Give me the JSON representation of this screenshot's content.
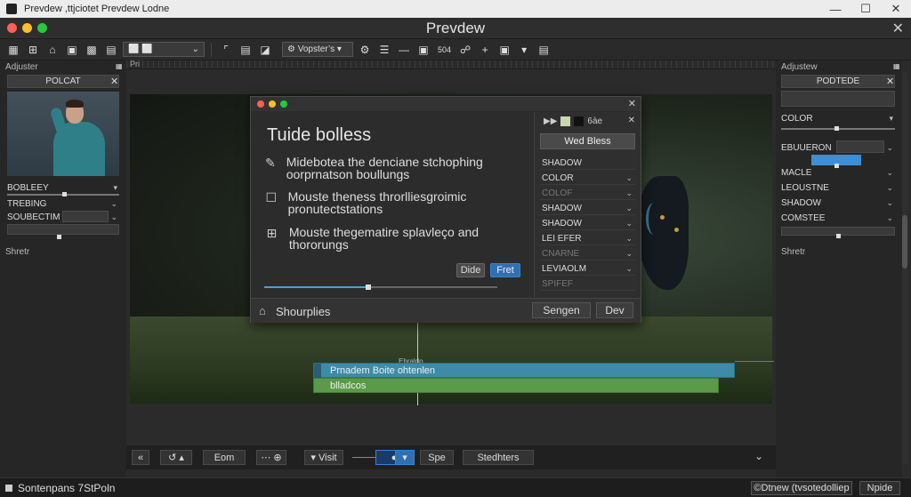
{
  "window": {
    "os_title": "Prevdew ,ttjciotet Prevdew Lodne",
    "app_title": "Prevdew"
  },
  "toolbar": {
    "select_left": "⬜ ⬜",
    "preset_label": "Vopster’s",
    "btn_504": "504",
    "ruler_label": "Pri"
  },
  "left_panel": {
    "label": "Adjuster",
    "head": "POLCAT",
    "props": [
      "BOBLEEY",
      "TREBING",
      "SOUBECTIM"
    ],
    "footer": "Shretr"
  },
  "right_panel": {
    "label": "Adjustew",
    "head": "PODTEDE",
    "props": [
      "COLOR",
      "EBUUERON",
      "MACLE",
      "LEOUSTNE",
      "SHADOW",
      "COMSTEE"
    ],
    "footer": "Shretr"
  },
  "dialog": {
    "title": "Tuide bolless",
    "items": [
      "Midebotea the denciane stchophing oorprnatson boullungs",
      "Mouste theness throrlliesgroimic pronutectstations",
      "Mouste thegematire splavleço and thororungs"
    ],
    "btn_secondary": "Dide",
    "btn_primary": "Fret",
    "footer_label": "Shourplies",
    "footer_btn1": "Sengen",
    "footer_btn2": "Dev",
    "slider_value": 0.44
  },
  "dialog_list": {
    "top_label": "6àe",
    "head": "Wed Bless",
    "rows": [
      {
        "label": "SHADOW",
        "dim": false,
        "chev": false
      },
      {
        "label": "COLOR",
        "dim": false,
        "chev": true
      },
      {
        "label": "COLOF",
        "dim": true,
        "chev": true
      },
      {
        "label": "SHADOW",
        "dim": false,
        "chev": true
      },
      {
        "label": "SHADOW",
        "dim": false,
        "chev": true
      },
      {
        "label": "LEI EFER",
        "dim": false,
        "chev": true
      },
      {
        "label": "CNARNE",
        "dim": true,
        "chev": true
      },
      {
        "label": "LEVIAOLM",
        "dim": false,
        "chev": true
      },
      {
        "label": "SPIFEF",
        "dim": true,
        "chev": false
      }
    ]
  },
  "timeline": {
    "playhead_label": "Ehraldo",
    "track1": "Prnadem Boite ohtenlen",
    "track2": "blladcos"
  },
  "transport": {
    "btn_eom": "Eom",
    "btn_visit": "Visit",
    "btn_spe": "Spe",
    "btn_stedhters": "Stedhters"
  },
  "status": {
    "left": "Sontenpans 7StPoln",
    "btn1": "©Dtnew (tvsotedolliep",
    "btn2": "Npide"
  },
  "colors": {
    "accent_blue": "#3d8ba8",
    "accent_green": "#5a9a4a",
    "primary_button": "#2f6fb3",
    "traffic_red": "#ff5f57",
    "traffic_yellow": "#febc2e",
    "traffic_green": "#28c840"
  }
}
